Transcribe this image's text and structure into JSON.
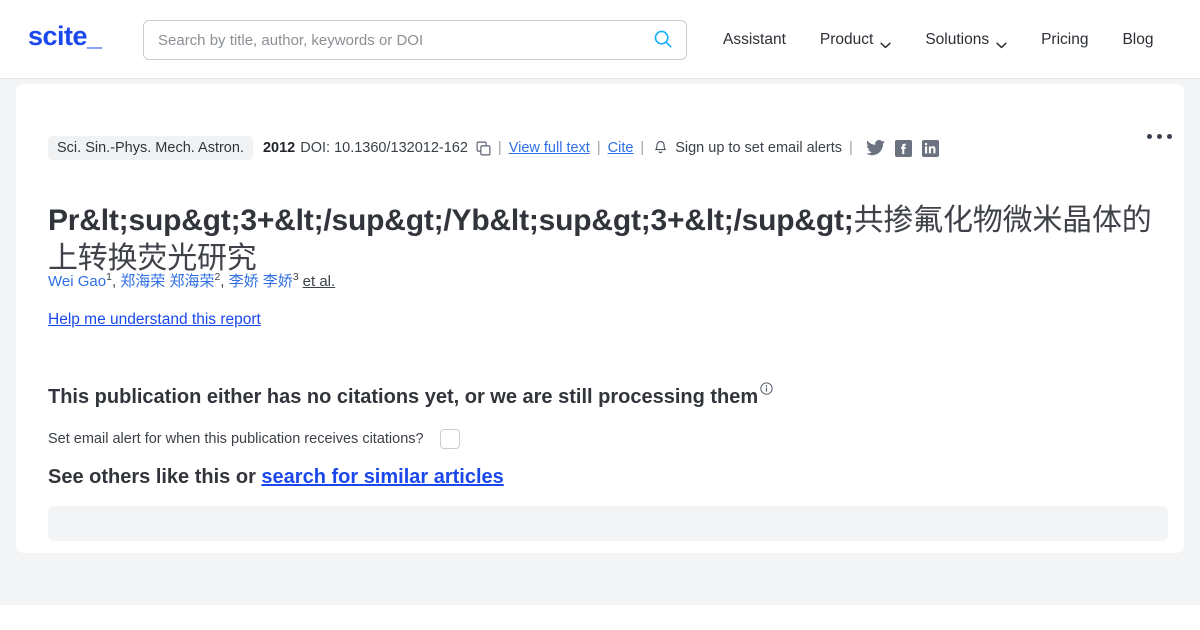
{
  "header": {
    "logo": "scite_",
    "search": {
      "placeholder": "Search by title, author, keywords or DOI",
      "value": ""
    },
    "nav": [
      {
        "label": "Assistant",
        "has_caret": false
      },
      {
        "label": "Product",
        "has_caret": true
      },
      {
        "label": "Solutions",
        "has_caret": true
      },
      {
        "label": "Pricing",
        "has_caret": false
      },
      {
        "label": "Blog",
        "has_caret": false
      }
    ]
  },
  "publication": {
    "journal": "Sci. Sin.-Phys. Mech. Astron.",
    "year": "2012",
    "doi": "DOI: 10.1360/132012-162",
    "view_full_text": "View full text",
    "cite": "Cite",
    "email_alerts": "Sign up to set email alerts",
    "separator": "|",
    "title_entity_part": "Pr&lt;sup&gt;3+&lt;/sup&gt;/Yb&lt;sup&gt;3+&lt;/sup&gt;",
    "title_cjk_part": "共掺氟化物微米晶体的上转换荧光研究",
    "authors": [
      {
        "name": "Wei Gao",
        "sup": "1",
        "is_link": true
      },
      {
        "name": "郑海荣 郑海荣",
        "sup": "2",
        "is_link": true
      },
      {
        "name": "李娇 李娇",
        "sup": "3",
        "is_link": true
      }
    ],
    "et_al": "et al.",
    "help_link": "Help me understand this report"
  },
  "citations": {
    "no_citations_heading": "This publication either has no citations yet, or we are still processing them",
    "set_alert_label": "Set email alert for when this publication receives citations?",
    "checkbox_checked": false,
    "see_others_prefix": "See others like this or ",
    "see_others_link": "search for similar articles"
  },
  "icons": {
    "search": "search-icon",
    "copy": "copy-icon",
    "bell": "bell-icon",
    "twitter": "twitter-icon",
    "facebook": "facebook-icon",
    "linkedin": "linkedin-icon",
    "info": "info-circle-icon",
    "kebab": "kebab-menu-icon",
    "caret": "chevron-down-icon"
  },
  "colors": {
    "brand_blue": "#1a48ed",
    "link_blue": "#2f6fe4",
    "search_icon": "#17aeff",
    "page_bg": "#f3f4f5",
    "text": "#31353b",
    "social_gray": "#6b7280"
  }
}
